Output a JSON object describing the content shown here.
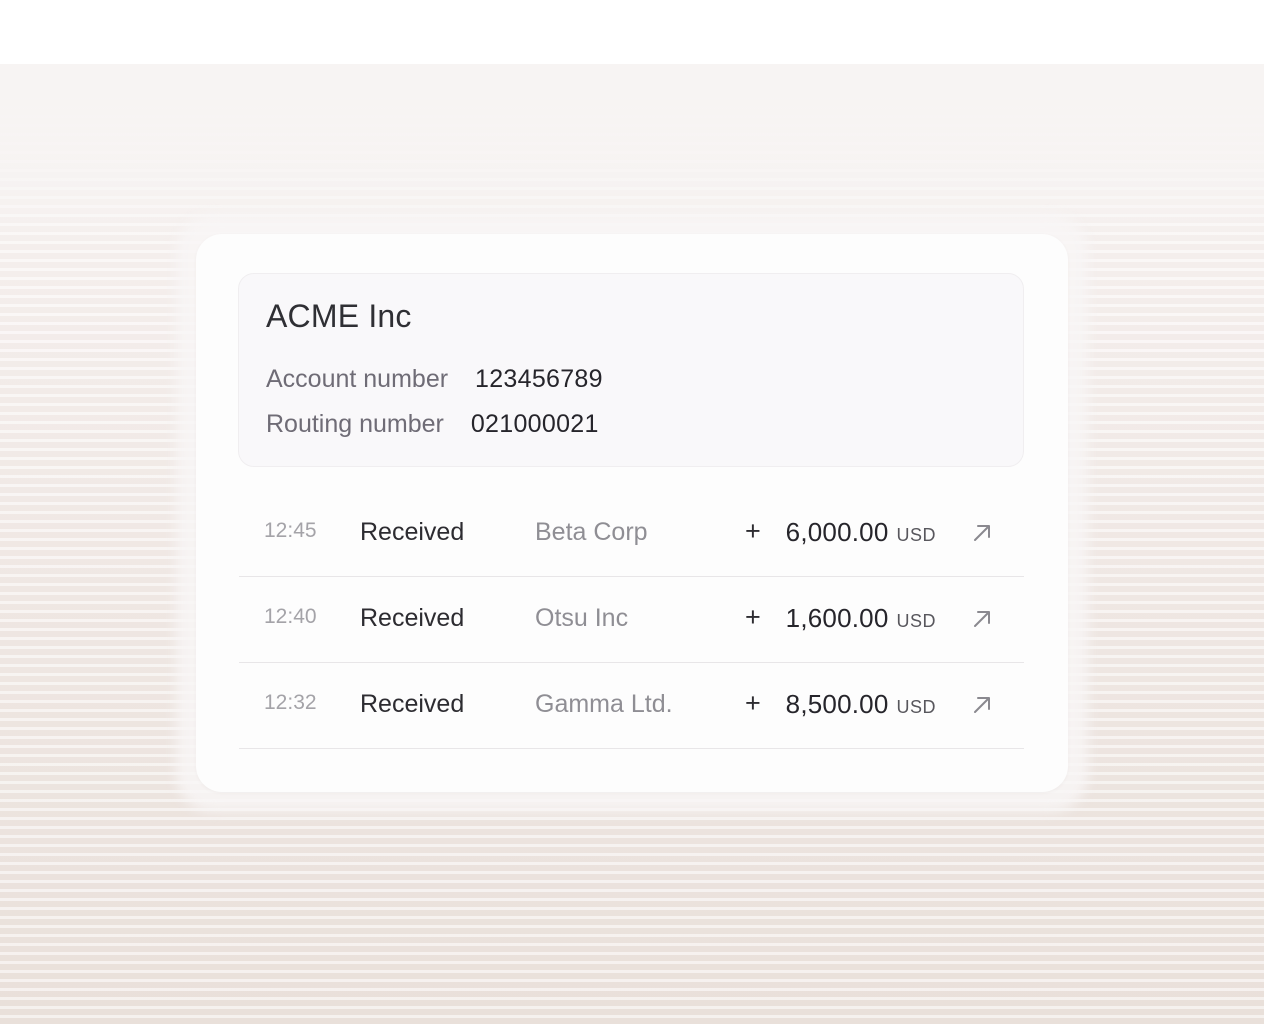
{
  "account": {
    "company_name": "ACME Inc",
    "account_number_label": "Account number",
    "account_number": "123456789",
    "routing_number_label": "Routing number",
    "routing_number": "021000021"
  },
  "transactions": [
    {
      "time": "12:45",
      "status": "Received",
      "counterparty": "Beta Corp",
      "sign": "+",
      "amount": "6,000.00",
      "currency": "USD",
      "icon": "arrow-up-right-icon"
    },
    {
      "time": "12:40",
      "status": "Received",
      "counterparty": "Otsu Inc",
      "sign": "+",
      "amount": "1,600.00",
      "currency": "USD",
      "icon": "arrow-up-right-icon"
    },
    {
      "time": "12:32",
      "status": "Received",
      "counterparty": "Gamma Ltd.",
      "sign": "+",
      "amount": "8,500.00",
      "currency": "USD",
      "icon": "arrow-up-right-icon"
    }
  ],
  "colors": {
    "card_background": "#fdfdfd",
    "account_box_background": "#f9f8fa",
    "primary_text": "#26252b",
    "secondary_text": "#8f8e94",
    "muted_text": "#a4a3a8",
    "backdrop": "#efe7e3"
  }
}
